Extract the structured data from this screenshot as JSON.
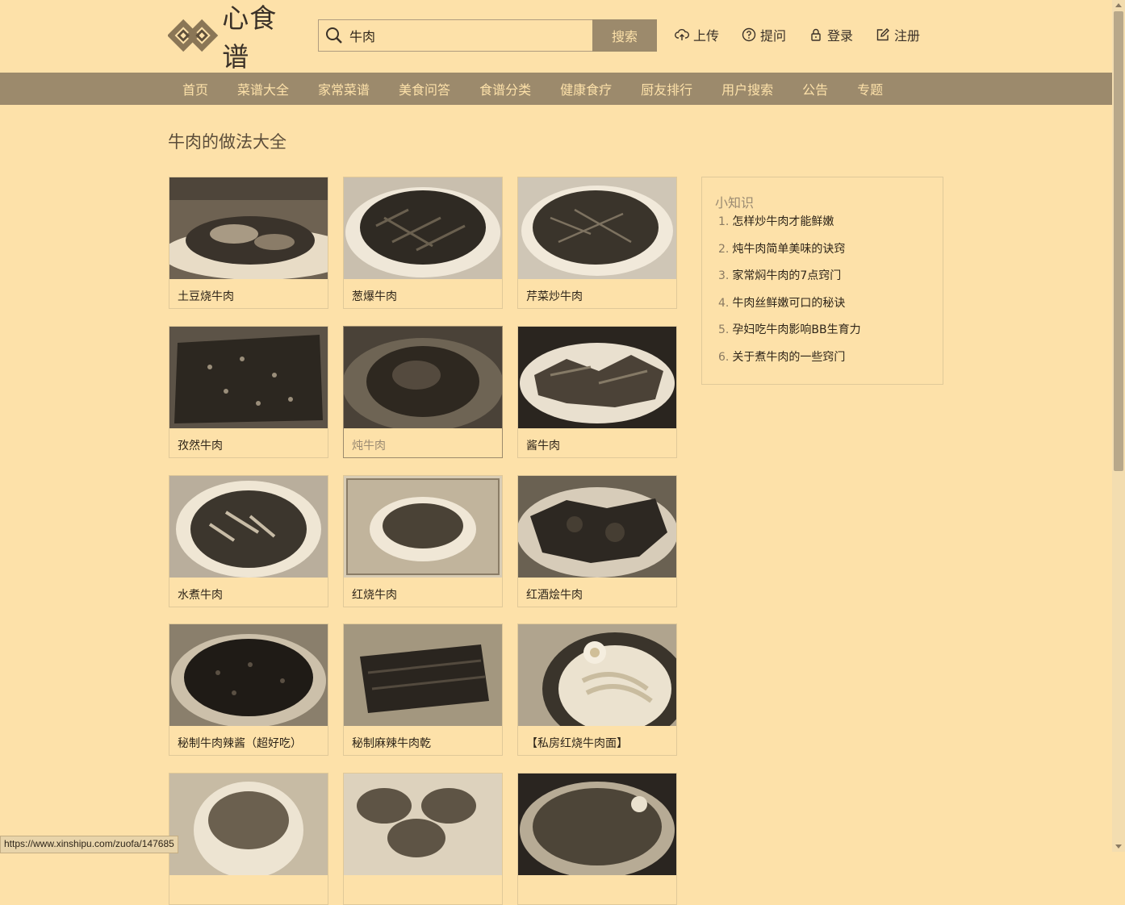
{
  "header": {
    "logo_text": "心食谱",
    "search": {
      "value": "牛肉",
      "button_label": "搜索"
    },
    "top_links": [
      {
        "label": "上传",
        "icon": "cloud-upload-icon"
      },
      {
        "label": "提问",
        "icon": "question-circle-icon"
      },
      {
        "label": "登录",
        "icon": "lock-icon"
      },
      {
        "label": "注册",
        "icon": "edit-icon"
      }
    ]
  },
  "nav": {
    "items": [
      "首页",
      "菜谱大全",
      "家常菜谱",
      "美食问答",
      "食谱分类",
      "健康食疗",
      "厨友排行",
      "用户搜索",
      "公告",
      "专题"
    ]
  },
  "main": {
    "title": "牛肉的做法大全",
    "recipes": [
      "土豆烧牛肉",
      "葱爆牛肉",
      "芹菜炒牛肉",
      "孜然牛肉",
      "炖牛肉",
      "酱牛肉",
      "水煮牛肉",
      "红烧牛肉",
      "红酒烩牛肉",
      "秘制牛肉辣酱（超好吃）",
      "秘制麻辣牛肉乾",
      "【私房红烧牛肉面】",
      "",
      "",
      ""
    ]
  },
  "sidebar": {
    "title": "小知识",
    "tips": [
      {
        "num": "1.",
        "text": "怎样炒牛肉才能鲜嫩"
      },
      {
        "num": "2.",
        "text": "炖牛肉简单美味的诀窍"
      },
      {
        "num": "3.",
        "text": "家常焖牛肉的7点窍门"
      },
      {
        "num": "4.",
        "text": "牛肉丝鲜嫩可口的秘诀"
      },
      {
        "num": "5.",
        "text": "孕妇吃牛肉影响BB生育力"
      },
      {
        "num": "6.",
        "text": "关于煮牛肉的一些窍门"
      }
    ]
  },
  "status_bar": {
    "url": "https://www.xinshipu.com/zuofa/147685"
  },
  "colors": {
    "background": "#fde1a9",
    "nav": "#9c8a6c",
    "text": "#2e2519"
  }
}
